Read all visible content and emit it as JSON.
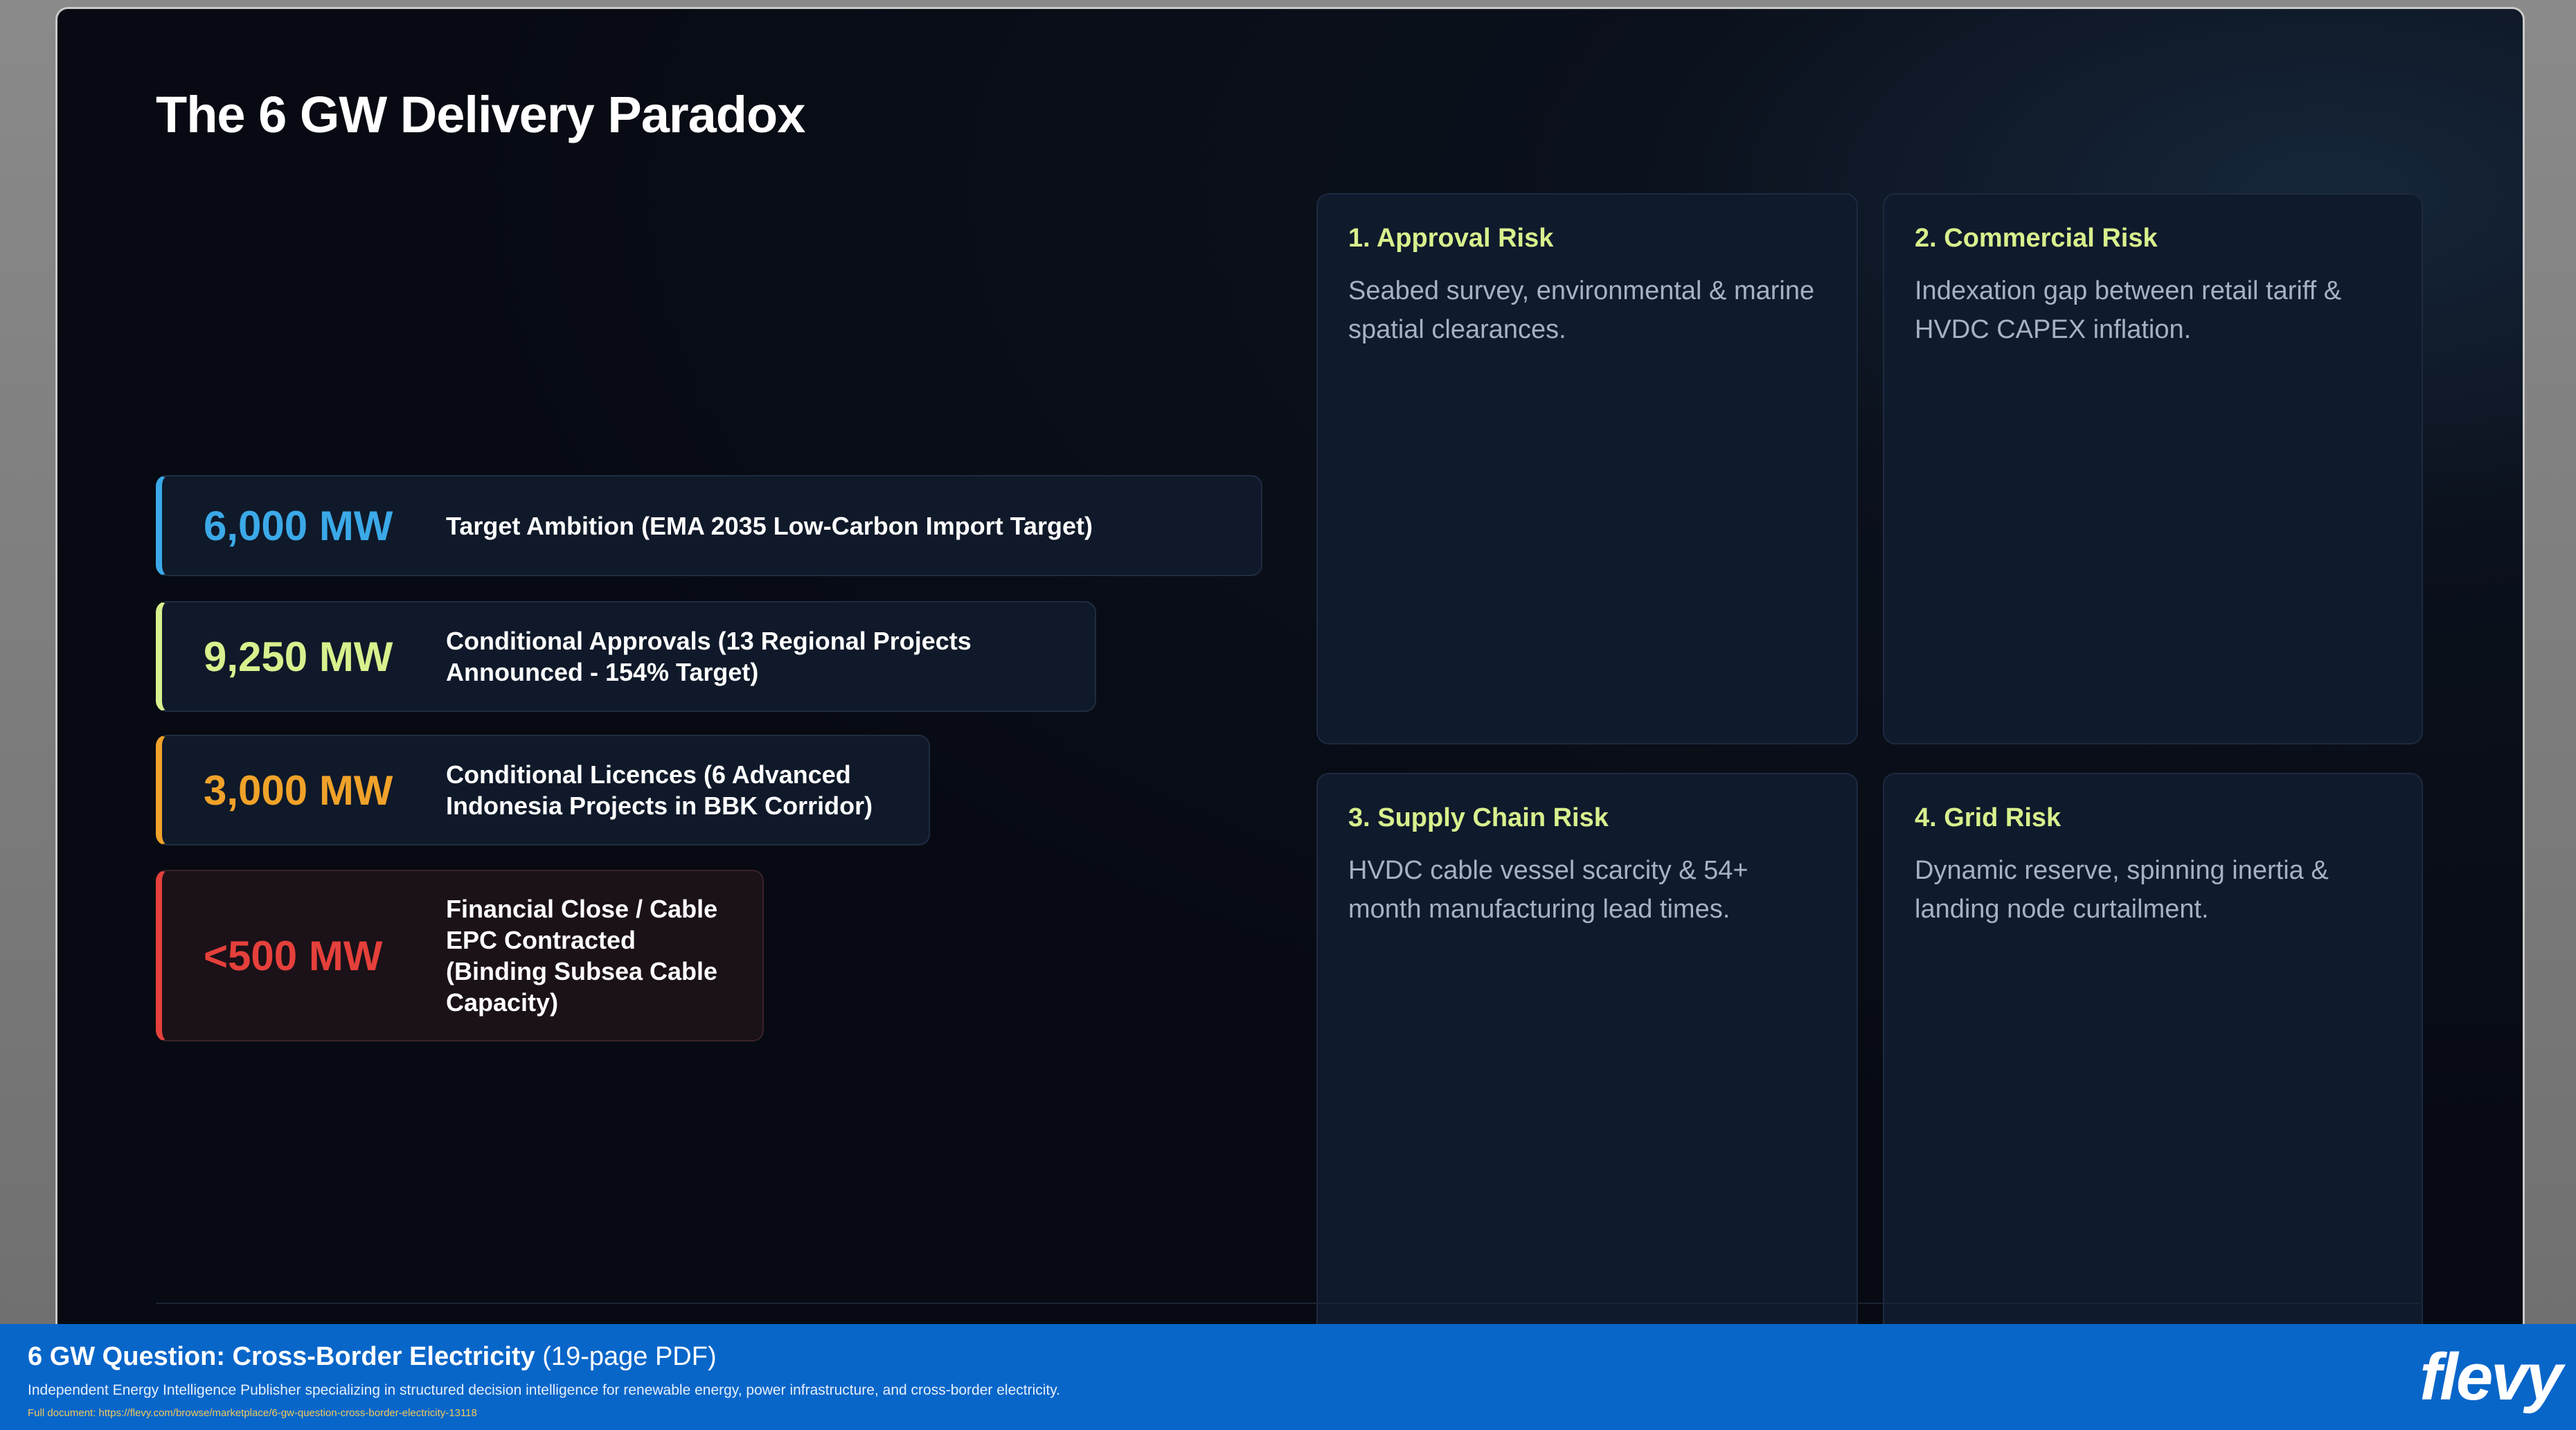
{
  "slide": {
    "title": "The 6 GW Delivery Paradox",
    "metrics": [
      {
        "value": "6,000 MW",
        "desc": "Target Ambition (EMA 2035 Low-Carbon Import Target)"
      },
      {
        "value": "9,250 MW",
        "desc": "Conditional Approvals (13 Regional Projects Announced - 154% Target)"
      },
      {
        "value": "3,000 MW",
        "desc": "Conditional Licences (6 Advanced Indonesia Projects in BBK Corridor)"
      },
      {
        "value": "<500 MW",
        "desc": "Financial Close / Cable EPC Contracted (Binding Subsea Cable Capacity)"
      }
    ],
    "risks": [
      {
        "title": "1. Approval Risk",
        "text": "Seabed survey, environmental & marine spatial clearances."
      },
      {
        "title": "2. Commercial Risk",
        "text": "Indexation gap between retail tariff & HVDC CAPEX inflation."
      },
      {
        "title": "3. Supply Chain Risk",
        "text": "HVDC cable vessel scarcity & 54+ month manufacturing lead times."
      },
      {
        "title": "4. Grid Risk",
        "text": "Dynamic reserve, spinning inertia & landing node curtailment."
      }
    ]
  },
  "footer": {
    "doc_title": "6 GW Question: Cross-Border Electricity",
    "page_info": "(19-page PDF)",
    "description": "Independent Energy Intelligence Publisher specializing in structured decision intelligence for renewable energy, power infrastructure, and cross-border electricity.",
    "url": "Full document: https://flevy.com/browse/marketplace/6-gw-question-cross-border-electricity-13118",
    "logo": "flevy"
  },
  "colors": {
    "blue": "#3ba9e8",
    "lime": "#d8f08d",
    "orange": "#f0a22a",
    "red": "#e5403b",
    "footer_bg": "#0866c9"
  }
}
